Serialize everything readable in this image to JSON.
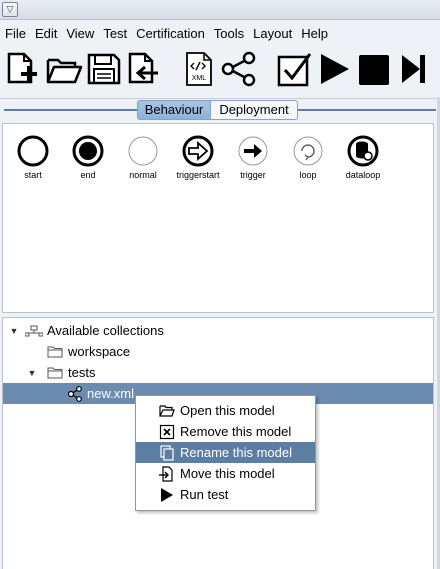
{
  "menubar": [
    "File",
    "Edit",
    "View",
    "Test",
    "Certification",
    "Tools",
    "Layout",
    "Help"
  ],
  "toolbar": {
    "buttons": [
      "new-model-icon",
      "open-folder-icon",
      "save-icon",
      "import-icon",
      "xml-file-icon",
      "share-graph-icon",
      "validate-check-icon",
      "run-play-icon",
      "stop-icon",
      "step-end-icon"
    ],
    "xml_label": "XML"
  },
  "tabs": {
    "behaviour": "Behaviour",
    "deployment": "Deployment"
  },
  "palette": [
    {
      "label": "start"
    },
    {
      "label": "end"
    },
    {
      "label": "normal"
    },
    {
      "label": "triggerstart"
    },
    {
      "label": "trigger"
    },
    {
      "label": "loop"
    },
    {
      "label": "dataloop"
    }
  ],
  "tree": {
    "root": "Available collections",
    "workspace": "workspace",
    "tests": "tests",
    "file": "new.xml"
  },
  "context_menu": {
    "open": "Open this model",
    "remove": "Remove this model",
    "rename": "Rename this model",
    "move": "Move this model",
    "run": "Run test"
  },
  "colors": {
    "selection": "#6b8cb0",
    "menu_hover": "#5d7ea4",
    "tab_active": "#9dbde1"
  }
}
